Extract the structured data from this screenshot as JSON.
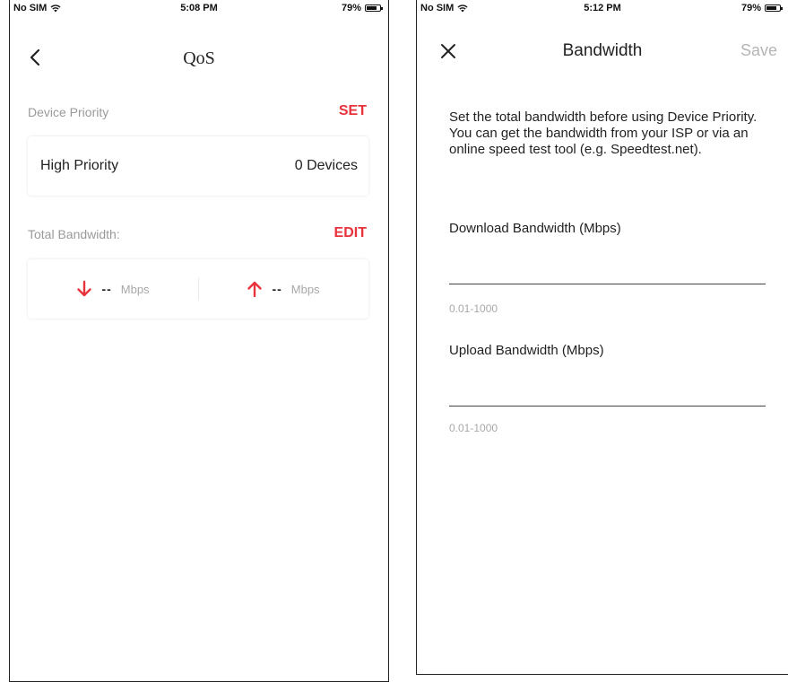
{
  "left_screen": {
    "status": {
      "carrier": "No SIM",
      "time": "5:08 PM",
      "battery": "79%",
      "battery_level": 0.79
    },
    "nav": {
      "title": "QoS"
    },
    "device_priority": {
      "header": "Device Priority",
      "action": "SET",
      "row_label": "High Priority",
      "row_value": "0 Devices"
    },
    "total_bandwidth": {
      "header": "Total Bandwidth:",
      "action": "EDIT",
      "download": {
        "value": "--",
        "unit": "Mbps",
        "color": "#e8323c"
      },
      "upload": {
        "value": "--",
        "unit": "Mbps",
        "color": "#e8323c"
      }
    }
  },
  "right_screen": {
    "status": {
      "carrier": "No SIM",
      "time": "5:12 PM",
      "battery": "79%",
      "battery_level": 0.79
    },
    "nav": {
      "title": "Bandwidth",
      "save_label": "Save"
    },
    "description": "Set the total bandwidth before using Device Priority. You can get the bandwidth from your ISP or via an online speed test tool (e.g. Speedtest.net).",
    "download": {
      "label": "Download Bandwidth (Mbps)",
      "value": "",
      "hint": "0.01-1000"
    },
    "upload": {
      "label": "Upload Bandwidth (Mbps)",
      "value": "",
      "hint": "0.01-1000"
    }
  },
  "colors": {
    "accent": "#e8323c",
    "muted": "#a8a8a8",
    "disabled": "#b5b5b5"
  }
}
